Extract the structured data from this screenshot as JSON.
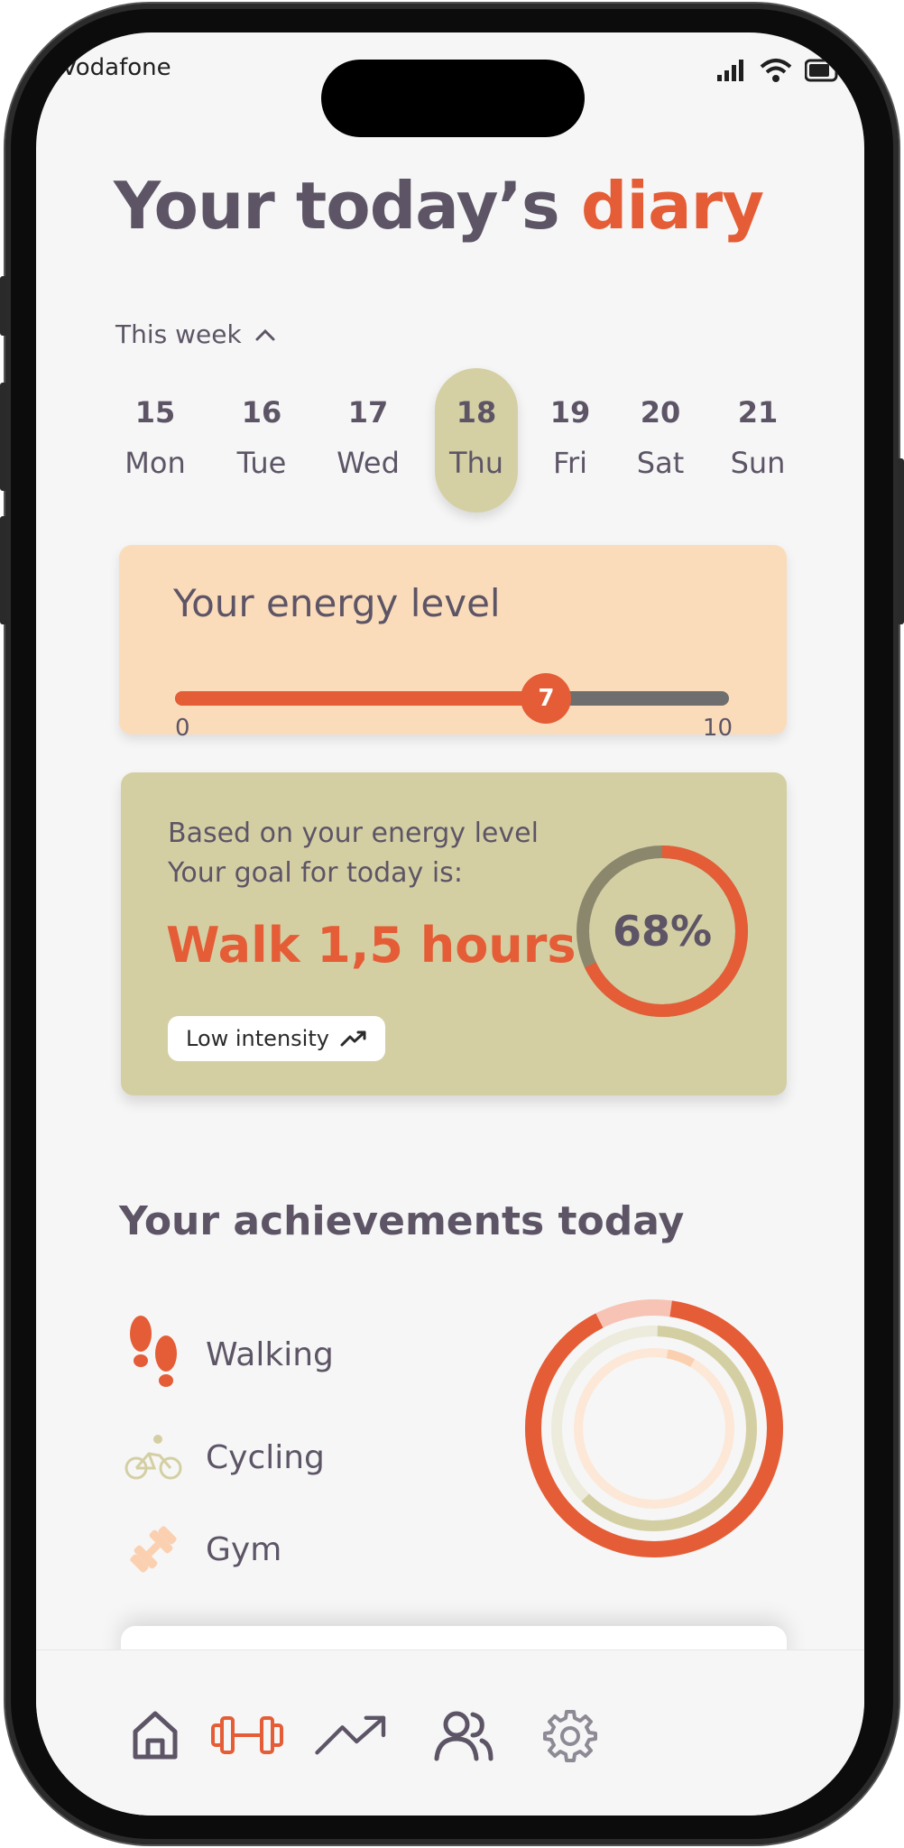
{
  "status_bar": {
    "carrier": "Vodafone"
  },
  "header": {
    "title_main": "Your today’s",
    "title_accent": "diary"
  },
  "week": {
    "toggle_label": "This week",
    "days": [
      {
        "num": "15",
        "name": "Mon",
        "selected": false
      },
      {
        "num": "16",
        "name": "Tue",
        "selected": false
      },
      {
        "num": "17",
        "name": "Wed",
        "selected": false
      },
      {
        "num": "18",
        "name": "Thu",
        "selected": true
      },
      {
        "num": "19",
        "name": "Fri",
        "selected": false
      },
      {
        "num": "20",
        "name": "Sat",
        "selected": false
      },
      {
        "num": "21",
        "name": "Sun",
        "selected": false
      }
    ]
  },
  "energy": {
    "label": "Your energy level",
    "value": "7",
    "min": "0",
    "max": "10",
    "value_fraction": 0.67
  },
  "goal": {
    "line1": "Based on your energy level",
    "line2": "Your goal for today is:",
    "main": "Walk 1,5 hours",
    "chip_label": "Low intensity",
    "chip_icon": "trend-up-icon",
    "percent_label": "68%",
    "percent_value": 0.68
  },
  "achievements": {
    "title": "Your achievements today",
    "items": [
      {
        "label": "Walking",
        "icon": "footsteps-icon"
      },
      {
        "label": "Cycling",
        "icon": "bicycle-icon"
      },
      {
        "label": "Gym",
        "icon": "dumbbell-icon"
      }
    ]
  },
  "colors": {
    "accent": "#e45d36",
    "text": "#5d5566",
    "energy_card": "#fbdcba",
    "olive": "#d4cfa3",
    "peach_light": "#fde7d6"
  },
  "nav": [
    {
      "icon": "home-icon",
      "active": false
    },
    {
      "icon": "dumbbell-icon",
      "active": true
    },
    {
      "icon": "trend-up-icon",
      "active": false
    },
    {
      "icon": "users-icon",
      "active": false
    },
    {
      "icon": "gear-icon",
      "active": false
    }
  ]
}
